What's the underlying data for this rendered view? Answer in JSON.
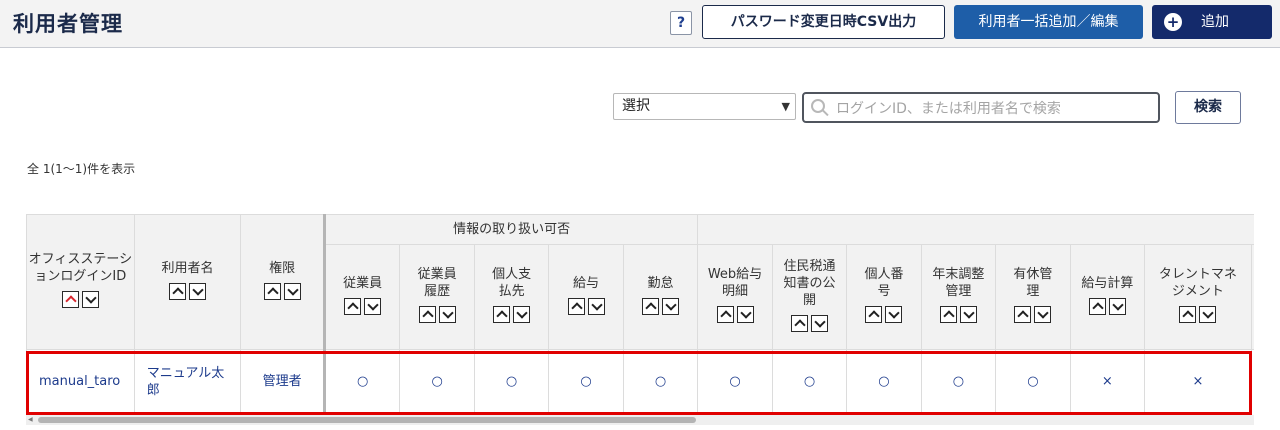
{
  "header": {
    "title": "利用者管理",
    "help_label": "?",
    "csv_button": "パスワード変更日時CSV出力",
    "bulk_button": "利用者一括追加／編集",
    "add_button": "追加",
    "add_icon": "+"
  },
  "search": {
    "select_value": "選択",
    "placeholder": "ログインID、または利用者名で検索",
    "button": "検索"
  },
  "count_text": "全 1(1～1)件を表示",
  "table": {
    "group_header": "情報の取り扱い可否",
    "columns": {
      "login_id": "オフィスステーションログインID",
      "user_name": "利用者名",
      "role": "権限",
      "employee": "従業員",
      "employee_history": "従業員履歴",
      "payee": "個人支払先",
      "salary": "給与",
      "attendance": "勤怠",
      "web_payslip": "Web給与明細",
      "resident_tax": "住民税通知書の公開",
      "my_number": "個人番号",
      "year_end": "年末調整管理",
      "paid_leave": "有休管理",
      "payroll": "給与計算",
      "talent": "タレントマネジメント"
    },
    "rows": [
      {
        "login_id": "manual_taro",
        "user_name": "マニュアル太郎",
        "role": "管理者",
        "employee": "○",
        "employee_history": "○",
        "payee": "○",
        "salary": "○",
        "attendance": "○",
        "web_payslip": "○",
        "resident_tax": "○",
        "my_number": "○",
        "year_end": "○",
        "paid_leave": "○",
        "payroll": "×",
        "talent": "×"
      }
    ]
  },
  "icons": {
    "help": "question-icon",
    "add": "plus-circle-icon",
    "search": "search-icon",
    "sort_up": "chevron-up-icon",
    "sort_down": "chevron-down-icon"
  },
  "colors": {
    "add_button": "#142a6b",
    "bulk_button": "#1e5ea8",
    "link_text": "#1d3b8c",
    "highlight": "#e00000",
    "active_sort": "#d8262e"
  }
}
